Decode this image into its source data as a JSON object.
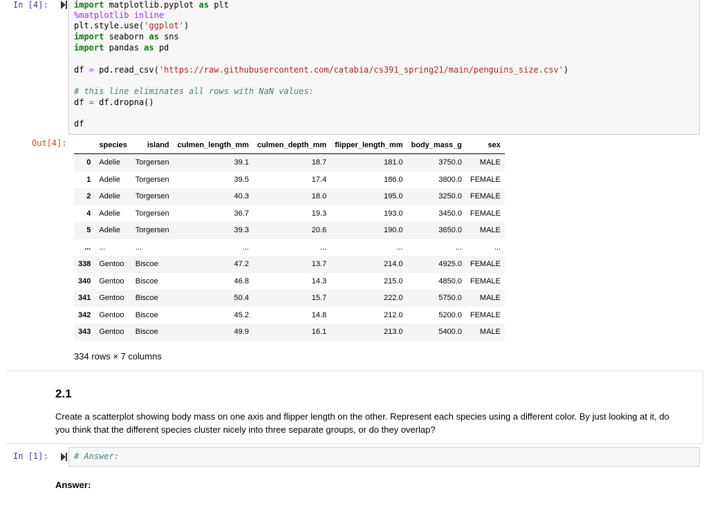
{
  "cells": {
    "code_cell_1": {
      "prompt": "In [4]:",
      "lines": {
        "l1": {
          "kw1": "import",
          "mod": " matplotlib.pyplot ",
          "kw2": "as",
          "alias": " plt"
        },
        "l2": {
          "magic": "%matplotlib inline"
        },
        "l3": {
          "pre": "plt.style.use(",
          "str": "'ggplot'",
          "post": ")"
        },
        "l4": {
          "kw1": "import",
          "mod": " seaborn ",
          "kw2": "as",
          "alias": " sns"
        },
        "l5": {
          "kw1": "import",
          "mod": " pandas ",
          "kw2": "as",
          "alias": " pd"
        },
        "l6": {
          "pre": "df ",
          "op": "=",
          "mid": " pd.read_csv(",
          "str": "'https://raw.githubusercontent.com/catabia/cs391_spring21/main/penguins_size.csv'",
          "post": ")"
        },
        "l7": {
          "comment": "# this line eliminates all rows with NaN values:"
        },
        "l8": {
          "pre": "df ",
          "op": "=",
          "post": " df.dropna()"
        },
        "l9": {
          "text": "df"
        }
      }
    },
    "output_1": {
      "prompt": "Out[4]:",
      "columns": [
        "",
        "species",
        "island",
        "culmen_length_mm",
        "culmen_depth_mm",
        "flipper_length_mm",
        "body_mass_g",
        "sex"
      ],
      "rows": [
        [
          "0",
          "Adelie",
          "Torgersen",
          "39.1",
          "18.7",
          "181.0",
          "3750.0",
          "MALE"
        ],
        [
          "1",
          "Adelie",
          "Torgersen",
          "39.5",
          "17.4",
          "186.0",
          "3800.0",
          "FEMALE"
        ],
        [
          "2",
          "Adelie",
          "Torgersen",
          "40.3",
          "18.0",
          "195.0",
          "3250.0",
          "FEMALE"
        ],
        [
          "4",
          "Adelie",
          "Torgersen",
          "36.7",
          "19.3",
          "193.0",
          "3450.0",
          "FEMALE"
        ],
        [
          "5",
          "Adelie",
          "Torgersen",
          "39.3",
          "20.6",
          "190.0",
          "3650.0",
          "MALE"
        ],
        [
          "...",
          "...",
          "...",
          "...",
          "...",
          "...",
          "...",
          "..."
        ],
        [
          "338",
          "Gentoo",
          "Biscoe",
          "47.2",
          "13.7",
          "214.0",
          "4925.0",
          "FEMALE"
        ],
        [
          "340",
          "Gentoo",
          "Biscoe",
          "46.8",
          "14.3",
          "215.0",
          "4850.0",
          "FEMALE"
        ],
        [
          "341",
          "Gentoo",
          "Biscoe",
          "50.4",
          "15.7",
          "222.0",
          "5750.0",
          "MALE"
        ],
        [
          "342",
          "Gentoo",
          "Biscoe",
          "45.2",
          "14.8",
          "212.0",
          "5200.0",
          "FEMALE"
        ],
        [
          "343",
          "Gentoo",
          "Biscoe",
          "49.9",
          "16.1",
          "213.0",
          "5400.0",
          "MALE"
        ]
      ],
      "shape_note": "334 rows × 7 columns"
    },
    "markdown_1": {
      "heading": "2.1",
      "paragraph": "Create a scatterplot showing body mass on one axis and flipper length on the other. Represent each species using a different color. By just looking at it, do you think that the different species cluster nicely into three separate groups, or do they overlap?"
    },
    "code_cell_2": {
      "prompt": "In [1]:",
      "comment": "# Answer:"
    },
    "answer_label": "Answer:"
  },
  "colors": {
    "prompt_in": "#303f9f",
    "prompt_out": "#d84315",
    "keyword": "#008000",
    "string": "#ba2121",
    "comment": "#408080",
    "magic": "#aa22ff"
  },
  "icons": {
    "run": "run-triangle-icon"
  }
}
